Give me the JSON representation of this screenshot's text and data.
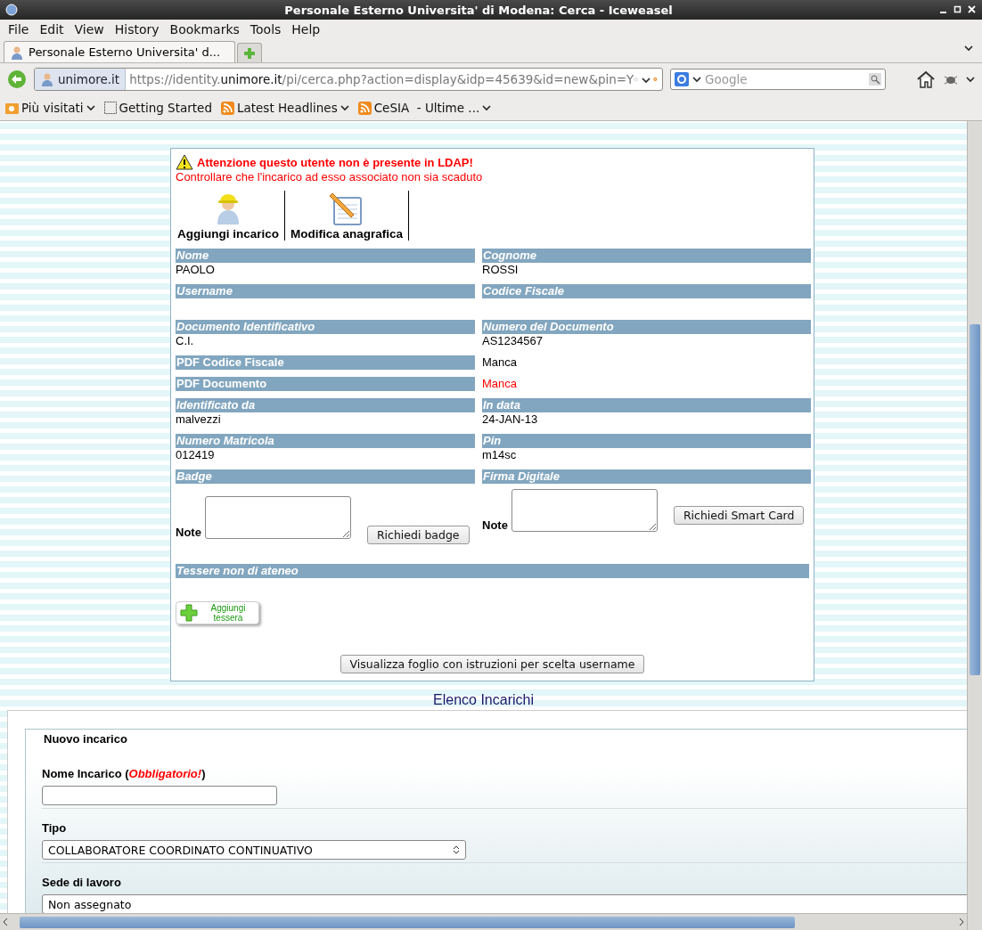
{
  "window": {
    "title": "Personale Esterno Universita' di Modena: Cerca - Iceweasel"
  },
  "menu": [
    "File",
    "Edit",
    "View",
    "History",
    "Bookmarks",
    "Tools",
    "Help"
  ],
  "tabs": [
    {
      "label": "Personale Esterno Universita' d...",
      "selected": true
    }
  ],
  "address": {
    "site": "unimore.it",
    "url_prefix": "https://identity.",
    "url_domain": "unimore.it",
    "url_rest": "/pi/cerca.php?action=display&idp=45639&id=new&pin=Y"
  },
  "search": {
    "placeholder": "Google"
  },
  "bookmarks": [
    {
      "label": "Più visitati",
      "kind": "folder",
      "menu": true
    },
    {
      "label": "Getting Started",
      "kind": "page",
      "menu": false
    },
    {
      "label": "Latest Headlines",
      "kind": "feed",
      "menu": true
    },
    {
      "label": "CeSIA  - Ultime ...",
      "kind": "feed",
      "menu": true
    }
  ],
  "warning": {
    "title": "Attenzione questo utente non è presente in LDAP!",
    "message": "Controllare che l'incarico ad esso associato non sia scaduto"
  },
  "actions": [
    {
      "label": "Aggiungi incarico",
      "kind": "worker"
    },
    {
      "label": "Modifica anagrafica",
      "kind": "notepad"
    }
  ],
  "rows": [
    {
      "kind": "pair",
      "cells": [
        {
          "label": "Nome",
          "value": "PAOLO"
        },
        {
          "label": "Cognome",
          "value": "ROSSI"
        }
      ]
    },
    {
      "kind": "pair",
      "cells": [
        {
          "label": "Username"
        },
        {
          "label": "Codice Fiscale"
        }
      ]
    },
    {
      "kind": "pair",
      "cells": [
        {
          "label": "Documento Identificativo",
          "value": "C.I."
        },
        {
          "label": "Numero del Documento",
          "value": "AS1234567"
        }
      ]
    },
    {
      "kind": "inline",
      "label": "PDF Codice Fiscale",
      "value": "Manca",
      "alert": false
    },
    {
      "kind": "inline",
      "label": "PDF Documento",
      "value": "Manca",
      "alert": true
    },
    {
      "kind": "pair",
      "cells": [
        {
          "label": "Identificato da",
          "value": "malvezzi"
        },
        {
          "label": "In data",
          "value": "24-JAN-13"
        }
      ]
    },
    {
      "kind": "pair",
      "cells": [
        {
          "label": "Numero Matricola",
          "value": "012419"
        },
        {
          "label": "Pin",
          "value": "m14sc"
        }
      ]
    }
  ],
  "requests": [
    {
      "label": "Badge",
      "note_label": "Note",
      "button": "Richiedi badge"
    },
    {
      "label": "Firma Digitale",
      "note_label": "Note",
      "button": "Richiedi Smart Card"
    }
  ],
  "cards_section": {
    "label": "Tessere non di ateneo",
    "add_button": "Aggiungi tessera"
  },
  "instructions_button": "Visualizza foglio con istruzioni per scelta username",
  "assignments": {
    "heading": "Elenco Incarichi",
    "legend": "Nuovo incarico",
    "name_label": "Nome Incarico (*Obbligatorio!*)",
    "type_label": "Tipo",
    "type_value": "COLLABORATORE COORDINATO CONTINUATIVO",
    "site_label": "Sede di lavoro",
    "site_value": "Non assegnato"
  }
}
